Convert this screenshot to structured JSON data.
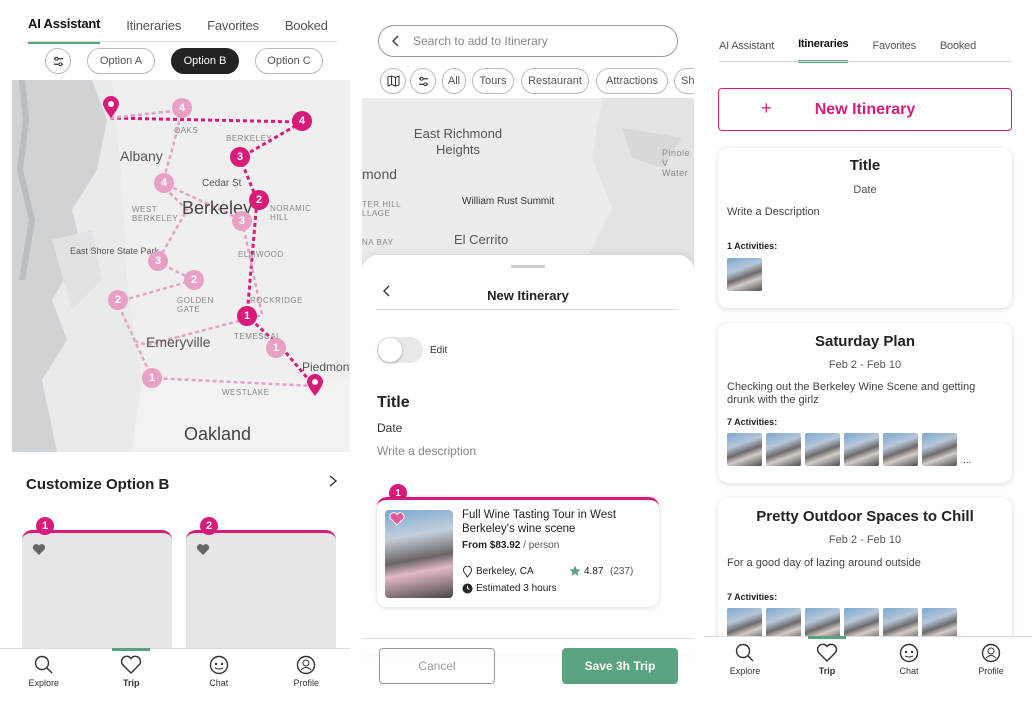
{
  "screen1": {
    "tabs": [
      "AI Assistant",
      "Itineraries",
      "Favorites",
      "Booked"
    ],
    "options": [
      "Option A",
      "Option B",
      "Option C"
    ],
    "map_labels": {
      "oaks": "OAKS",
      "berkeley_small": "BERKELEY",
      "albany": "Albany",
      "cedar": "Cedar St",
      "west_berkeley": "WEST BERKELEY",
      "berkeley": "Berkeley",
      "panoramic": "NORAMIC HILL",
      "east_shore": "East Shore State Park",
      "elmwood": "ELMWOOD",
      "golden_gate": "GOLDEN GATE",
      "rockridge": "ROCKRIDGE",
      "temescal": "TEMESCAL",
      "emeryville": "Emeryville",
      "piedmont": "Piedmont",
      "westlake": "WESTLAKE",
      "oakland": "Oakland"
    },
    "markers": {
      "m1": "1",
      "m2": "2",
      "m3": "3",
      "m4": "4",
      "f1": "1",
      "f2": "2",
      "f3": "3",
      "f4": "4",
      "f2b": "2",
      "f3b": "3",
      "f4b": "4",
      "f1b": "1"
    },
    "customize_title": "Customize Option B",
    "card_numbers": [
      "1",
      "2"
    ]
  },
  "screen2": {
    "search_placeholder": "Search to add to Itinerary",
    "filters": [
      "All",
      "Tours",
      "Restaurant",
      "Attractions",
      "Sh"
    ],
    "map_labels": {
      "east_richmond": "East Richmond Heights",
      "mond": "mond",
      "pinole": "Pinole V Water",
      "william": "William Rust Summit",
      "el_cerrito": "El Cerrito",
      "ter_hill": "TER HILL LLAGE",
      "na_bay": "NA BAY"
    },
    "sheet_title": "New Itinerary",
    "edit_label": "Edit",
    "title_label": "Title",
    "date_label": "Date",
    "description_placeholder": "Write a description",
    "activity": {
      "number": "1",
      "name": "Full Wine Tasting Tour in West Berkeley's wine scene",
      "price_prefix": "From ",
      "price": "$83.92",
      "price_suffix": " / person",
      "location": "Berkeley, CA",
      "rating": "4.87",
      "reviews": "(237)",
      "duration": "Estimated 3 hours"
    },
    "cancel_label": "Cancel",
    "save_label": "Save 3h Trip"
  },
  "screen3": {
    "tabs": [
      "AI Assistant",
      "Itineraries",
      "Favorites",
      "Booked"
    ],
    "new_itinerary": "New Itinerary",
    "plus": "+",
    "cards": [
      {
        "title": "Title",
        "date": "Date",
        "description": "Write a Description",
        "activities": "1 Activities:",
        "thumbs": 1,
        "more": ""
      },
      {
        "title": "Saturday Plan",
        "date": "Feb 2 - Feb 10",
        "description": "Checking out the Berkeley Wine Scene and getting drunk with the girlz",
        "activities": "7 Activities:",
        "thumbs": 6,
        "more": "..."
      },
      {
        "title": "Pretty Outdoor Spaces to Chill",
        "date": "Feb 2 - Feb 10",
        "description": "For a good day of lazing around outside",
        "activities": "7 Activities:",
        "thumbs": 6,
        "more": ""
      }
    ]
  },
  "nav": [
    "Explore",
    "Trip",
    "Chat",
    "Profile"
  ],
  "colors": {
    "accent": "#d81b7a",
    "green": "#5aa37f",
    "dark": "#222222"
  }
}
